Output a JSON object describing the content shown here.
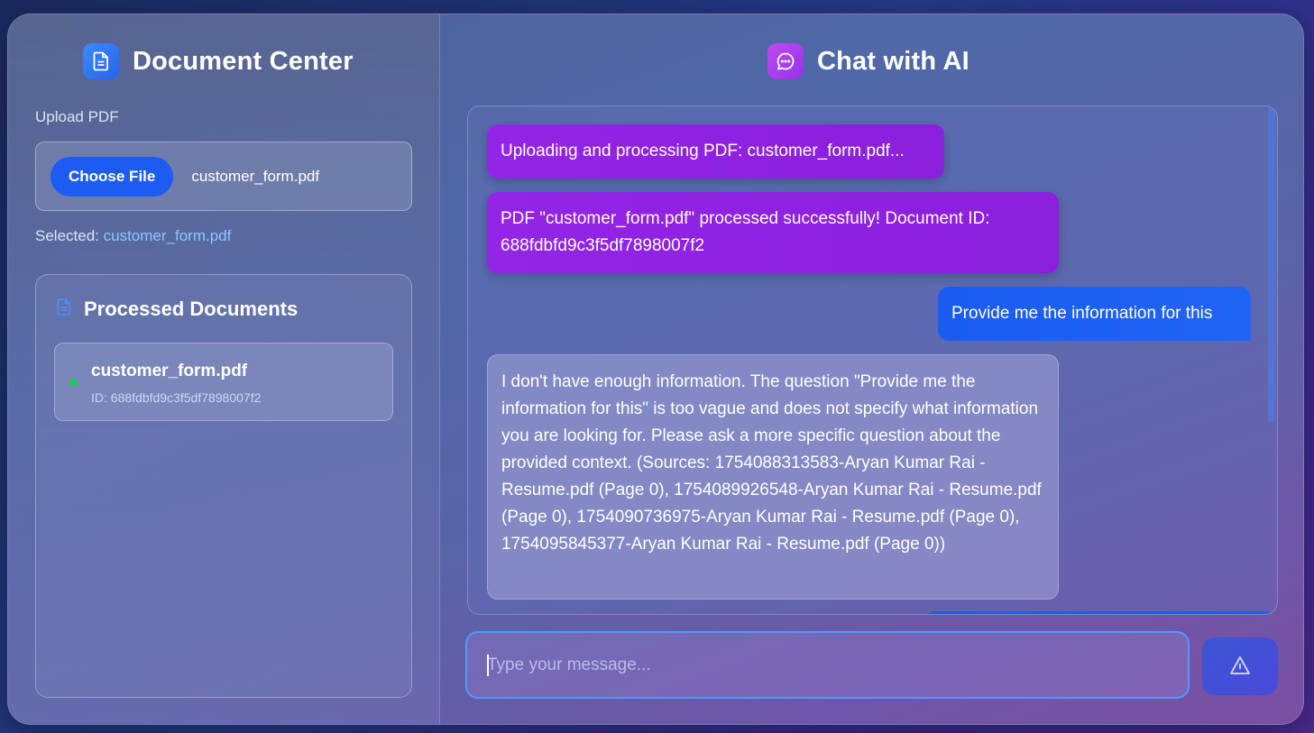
{
  "left_panel": {
    "title": "Document Center",
    "title_icon": "document-icon",
    "upload_label": "Upload PDF",
    "choose_button_label": "Choose File",
    "chosen_file_name": "customer_form.pdf",
    "selected_prefix": "Selected:",
    "selected_file": "customer_form.pdf",
    "processed": {
      "title": "Processed Documents",
      "icon": "document-icon",
      "documents": [
        {
          "name": "customer_form.pdf",
          "id_text": "ID: 688fdbfd9c3f5df7898007f2",
          "status": "green"
        }
      ]
    }
  },
  "chat": {
    "title": "Chat with AI",
    "title_icon": "chat-bubble-icon",
    "messages": [
      {
        "role": "system",
        "text": "Uploading and processing PDF: customer_form.pdf..."
      },
      {
        "role": "system",
        "text": "PDF \"customer_form.pdf\" processed successfully! Document ID: 688fdbfd9c3f5df7898007f2"
      },
      {
        "role": "user",
        "text": "Provide me the information for this"
      },
      {
        "role": "assistant",
        "text": "I don't have enough information. The question \"Provide me the information for this\" is too vague and does not specify what information you are looking for. Please ask a more specific question about the provided context. (Sources: 1754088313583-Aryan Kumar Rai - Resume.pdf (Page 0), 1754089926548-Aryan Kumar Rai - Resume.pdf (Page 0), 1754090736975-Aryan Kumar Rai - Resume.pdf (Page 0), 1754095845377-Aryan Kumar Rai - Resume.pdf (Page 0))"
      }
    ],
    "input": {
      "value": "",
      "placeholder": "Type your message..."
    },
    "send_icon": "send-icon"
  },
  "colors": {
    "accent_blue": "#1d5cf2",
    "system_message": "#9325e6",
    "status_green": "#22c55e",
    "link_blue": "#8ec5ff"
  }
}
